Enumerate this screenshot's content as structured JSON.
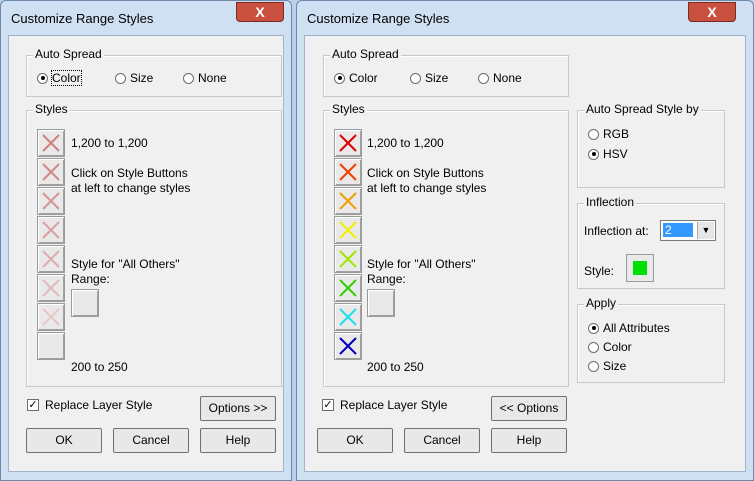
{
  "left": {
    "title": "Customize Range Styles",
    "close_label": "X",
    "auto_spread": {
      "legend": "Auto Spread",
      "options": [
        "Color",
        "Size",
        "None"
      ],
      "selected": "Color"
    },
    "styles": {
      "legend": "Styles",
      "top_range": "1,200 to 1,200",
      "hint1": "Click on Style Buttons",
      "hint2": "at left to change styles",
      "others1": "Style for \"All Others\"",
      "others2": "Range:",
      "bottom_range": "200 to 250"
    },
    "style_colors": [
      "#d08080",
      "#d08a8a",
      "#d59595",
      "#d9a0a0",
      "#ddabab",
      "#e2b8b8",
      "#e7c6c6",
      "none"
    ],
    "replace": {
      "label": "Replace Layer Style",
      "checked": true
    },
    "buttons": {
      "options": "Options >>",
      "ok": "OK",
      "cancel": "Cancel",
      "help": "Help"
    }
  },
  "right": {
    "title": "Customize Range Styles",
    "close_label": "X",
    "auto_spread": {
      "legend": "Auto Spread",
      "options": [
        "Color",
        "Size",
        "None"
      ],
      "selected": "Color"
    },
    "styles": {
      "legend": "Styles",
      "top_range": "1,200 to 1,200",
      "hint1": "Click on Style Buttons",
      "hint2": "at left to change styles",
      "others1": "Style for \"All Others\"",
      "others2": "Range:",
      "bottom_range": "200 to 250"
    },
    "style_colors": [
      "#e00000",
      "#f04000",
      "#f0a000",
      "#f0f000",
      "#a0e800",
      "#30d000",
      "#20e0f0",
      "#0000c0"
    ],
    "spread_by": {
      "legend": "Auto Spread Style by",
      "options": [
        "RGB",
        "HSV"
      ],
      "selected": "HSV"
    },
    "inflection": {
      "legend": "Inflection",
      "label": "Inflection at:",
      "value": "2",
      "style_label": "Style:",
      "style_color": "#00e000"
    },
    "apply": {
      "legend": "Apply",
      "options": [
        "All Attributes",
        "Color",
        "Size"
      ],
      "selected": "All Attributes"
    },
    "replace": {
      "label": "Replace Layer Style",
      "checked": true
    },
    "buttons": {
      "options": "<< Options",
      "ok": "OK",
      "cancel": "Cancel",
      "help": "Help"
    }
  }
}
